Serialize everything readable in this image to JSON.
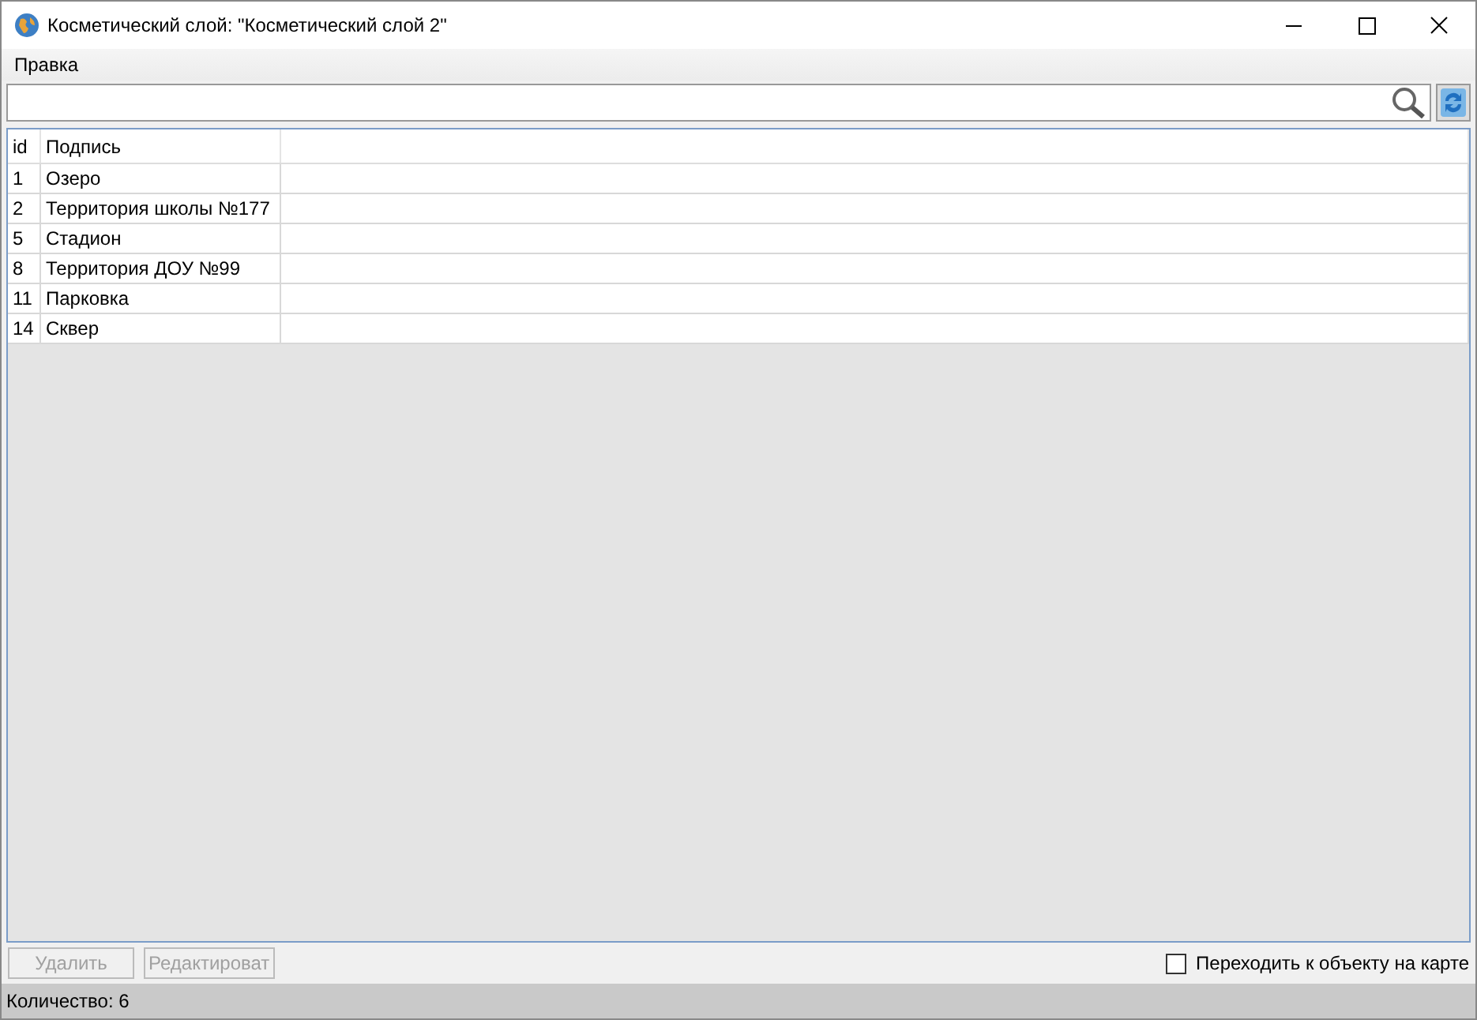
{
  "window": {
    "title": "Косметический слой: \"Косметический слой 2\""
  },
  "menu": [
    "Правка"
  ],
  "table": {
    "columns": [
      "id",
      "Подпись"
    ],
    "rows": [
      {
        "cells": [
          "1",
          "Озеро"
        ]
      },
      {
        "cells": [
          "2",
          "Территория школы №177"
        ]
      },
      {
        "cells": [
          "5",
          "Стадион"
        ]
      },
      {
        "cells": [
          "8",
          "Территория ДОУ №99"
        ]
      },
      {
        "cells": [
          "11",
          "Парковка"
        ]
      },
      {
        "cells": [
          "14",
          "Сквер"
        ]
      }
    ]
  },
  "buttons": [
    {
      "label": "Удалить",
      "disabled": true
    },
    {
      "label": "Редактироват",
      "disabled": true
    }
  ],
  "goto_checkbox": {
    "label": "Переходить к объекту на карте",
    "checked": false
  },
  "status_bar": "Количество: 6"
}
